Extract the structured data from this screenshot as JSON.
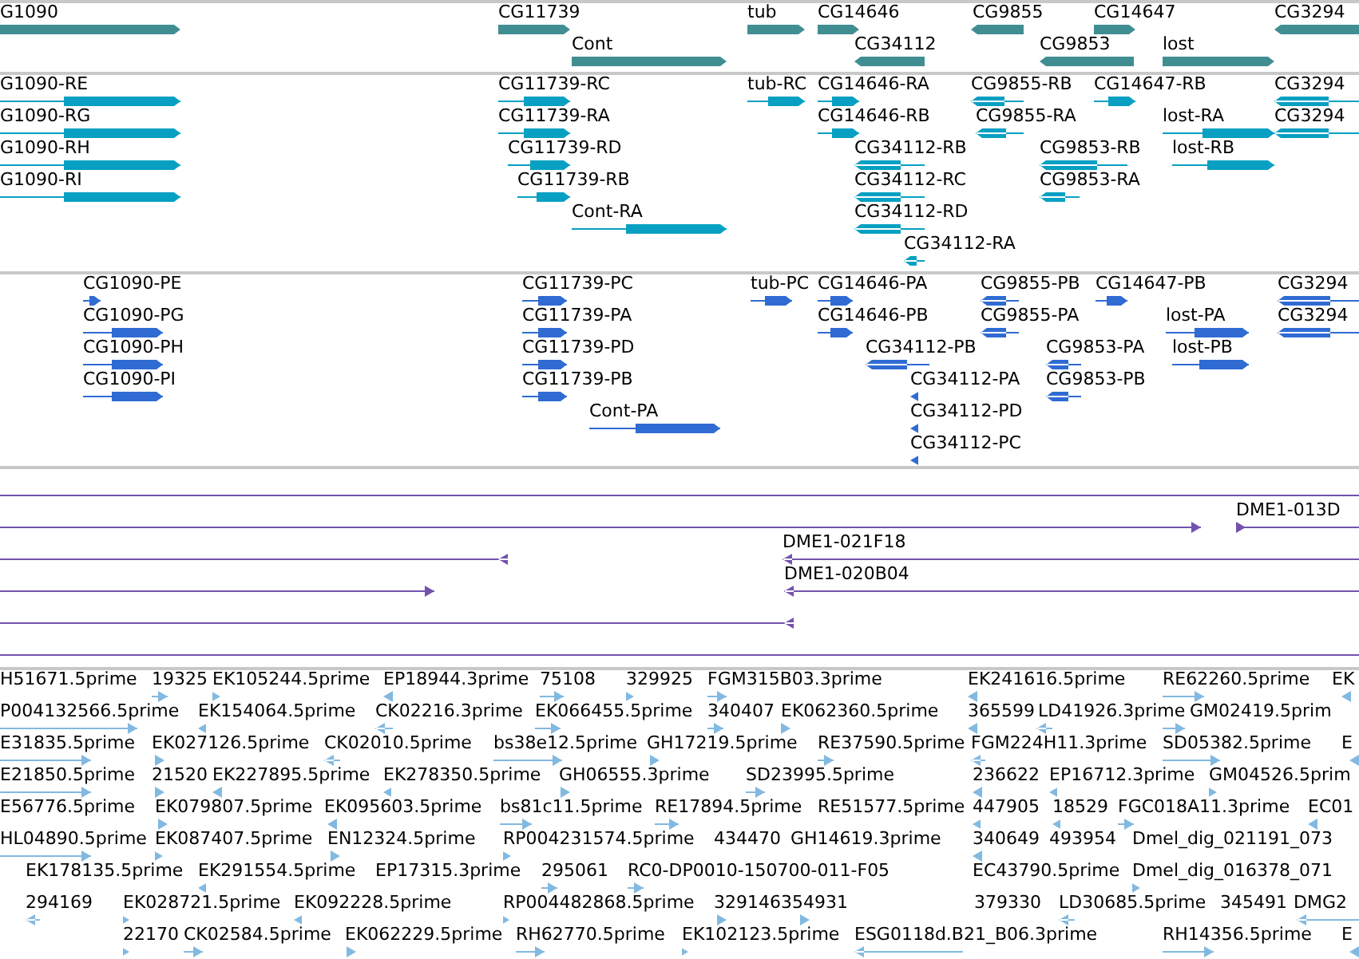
{
  "tracks": [
    {
      "kind": "gene",
      "features": [
        {
          "label": "G1090",
          "reverse": false
        },
        {
          "label": "CG11739",
          "reverse": false
        },
        {
          "label": "Cont",
          "reverse": false
        },
        {
          "label": "tub",
          "reverse": false
        },
        {
          "label": "CG14646",
          "reverse": false
        },
        {
          "label": "CG34112",
          "reverse": true
        },
        {
          "label": "CG9855",
          "reverse": true
        },
        {
          "label": "CG9853",
          "reverse": true
        },
        {
          "label": "CG14647",
          "reverse": false
        },
        {
          "label": "lost",
          "reverse": false
        },
        {
          "label": "CG3294",
          "reverse": true
        }
      ]
    },
    {
      "kind": "transcript",
      "features": [
        {
          "label": "G1090-RE",
          "reverse": false
        },
        {
          "label": "G1090-RG",
          "reverse": false
        },
        {
          "label": "G1090-RH",
          "reverse": false
        },
        {
          "label": "G1090-RI",
          "reverse": false
        },
        {
          "label": "CG11739-RC",
          "reverse": false
        },
        {
          "label": "CG11739-RA",
          "reverse": false
        },
        {
          "label": "CG11739-RD",
          "reverse": false
        },
        {
          "label": "CG11739-RB",
          "reverse": false
        },
        {
          "label": "Cont-RA",
          "reverse": false
        },
        {
          "label": "tub-RC",
          "reverse": false
        },
        {
          "label": "CG14646-RA",
          "reverse": false
        },
        {
          "label": "CG14646-RB",
          "reverse": false
        },
        {
          "label": "CG34112-RB",
          "reverse": true
        },
        {
          "label": "CG34112-RC",
          "reverse": true
        },
        {
          "label": "CG34112-RD",
          "reverse": true
        },
        {
          "label": "CG34112-RA",
          "reverse": true
        },
        {
          "label": "CG9855-RB",
          "reverse": true
        },
        {
          "label": "CG9855-RA",
          "reverse": true
        },
        {
          "label": "CG9853-RB",
          "reverse": true
        },
        {
          "label": "CG9853-RA",
          "reverse": true
        },
        {
          "label": "CG14647-RB",
          "reverse": false
        },
        {
          "label": "lost-RA",
          "reverse": false
        },
        {
          "label": "lost-RB",
          "reverse": false
        },
        {
          "label": "CG3294",
          "reverse": true
        },
        {
          "label": "CG3294",
          "reverse": true
        }
      ]
    },
    {
      "kind": "protein",
      "features": [
        {
          "label": "CG1090-PE",
          "reverse": false
        },
        {
          "label": "CG1090-PG",
          "reverse": false
        },
        {
          "label": "CG1090-PH",
          "reverse": false
        },
        {
          "label": "CG1090-PI",
          "reverse": false
        },
        {
          "label": "CG11739-PC",
          "reverse": false
        },
        {
          "label": "CG11739-PA",
          "reverse": false
        },
        {
          "label": "CG11739-PD",
          "reverse": false
        },
        {
          "label": "CG11739-PB",
          "reverse": false
        },
        {
          "label": "Cont-PA",
          "reverse": false
        },
        {
          "label": "tub-PC",
          "reverse": false
        },
        {
          "label": "CG14646-PA",
          "reverse": false
        },
        {
          "label": "CG14646-PB",
          "reverse": false
        },
        {
          "label": "CG34112-PB",
          "reverse": true
        },
        {
          "label": "CG34112-PA",
          "reverse": true
        },
        {
          "label": "CG34112-PD",
          "reverse": true
        },
        {
          "label": "CG34112-PC",
          "reverse": true
        },
        {
          "label": "CG9855-PB",
          "reverse": true
        },
        {
          "label": "CG9855-PA",
          "reverse": true
        },
        {
          "label": "CG9853-PA",
          "reverse": true
        },
        {
          "label": "CG9853-PB",
          "reverse": true
        },
        {
          "label": "CG14647-PB",
          "reverse": false
        },
        {
          "label": "lost-PA",
          "reverse": false
        },
        {
          "label": "lost-PB",
          "reverse": false
        },
        {
          "label": "CG3294",
          "reverse": true
        },
        {
          "label": "CG3294",
          "reverse": true
        }
      ]
    },
    {
      "kind": "match",
      "features": [
        {
          "end_shown": false
        },
        {
          "reverse": false
        },
        {
          "label": "DME1-013D",
          "reverse": false
        },
        {
          "reverse": true
        },
        {
          "label": "DME1-021F18",
          "reverse": true
        },
        {
          "reverse": false
        },
        {
          "label": "DME1-020B04",
          "reverse": true
        },
        {
          "reverse": true
        },
        {
          "end_shown": false
        }
      ]
    },
    {
      "kind": "est",
      "features": [
        {
          "label": "H51671.5prime"
        },
        {
          "label": "19325",
          "reverse": false
        },
        {
          "label": "EK105244.5prime",
          "reverse": false
        },
        {
          "label": "EP18944.3prime",
          "reverse": true
        },
        {
          "label": "75108",
          "reverse": false
        },
        {
          "label": "329925",
          "reverse": false
        },
        {
          "label": "FGM315B03.3prime",
          "reverse": false
        },
        {
          "label": "EK241616.5prime",
          "reverse": true
        },
        {
          "label": "RE62260.5prime",
          "reverse": false
        },
        {
          "label": "EK",
          "reverse": true
        },
        {
          "label": "P004132566.5prime",
          "reverse": false
        },
        {
          "label": "EK154064.5prime",
          "reverse": true
        },
        {
          "label": "CK02216.3prime",
          "reverse": true
        },
        {
          "label": "EK066455.5prime",
          "reverse": false
        },
        {
          "label": "340407",
          "reverse": false
        },
        {
          "label": "EK062360.5prime",
          "reverse": false
        },
        {
          "label": "365599",
          "reverse": true
        },
        {
          "label": "LD41926.3prime",
          "reverse": true
        },
        {
          "label": "GM02419.5prim",
          "reverse": false
        },
        {
          "label": "E31835.5prime",
          "reverse": false
        },
        {
          "label": "EK027126.5prime",
          "reverse": false
        },
        {
          "label": "CK02010.5prime",
          "reverse": true
        },
        {
          "label": "bs38e12.5prime",
          "reverse": false
        },
        {
          "label": "GH17219.5prime",
          "reverse": false
        },
        {
          "label": "RE37590.5prime",
          "reverse": false
        },
        {
          "label": "FGM224H11.3prime",
          "reverse": true
        },
        {
          "label": "SD05382.5prime",
          "reverse": false
        },
        {
          "label": "E",
          "reverse": true
        },
        {
          "label": "E21850.5prime",
          "reverse": false
        },
        {
          "label": "21520",
          "reverse": false
        },
        {
          "label": "EK227895.5prime",
          "reverse": true
        },
        {
          "label": "EK278350.5prime",
          "reverse": true
        },
        {
          "label": "GH06555.3prime",
          "reverse": false
        },
        {
          "label": "SD23995.5prime",
          "reverse": false
        },
        {
          "label": "236622",
          "reverse": true
        },
        {
          "label": "EP16712.3prime",
          "reverse": true
        },
        {
          "label": "GM04526.5prim",
          "reverse": false
        },
        {
          "label": "E56776.5prime"
        },
        {
          "label": "EK079807.5prime",
          "reverse": false
        },
        {
          "label": "EK095603.5prime",
          "reverse": true
        },
        {
          "label": "bs81c11.5prime",
          "reverse": false
        },
        {
          "label": "RE17894.5prime",
          "reverse": false
        },
        {
          "label": "RE51577.5prime"
        },
        {
          "label": "447905",
          "reverse": true
        },
        {
          "label": "18529",
          "reverse": true
        },
        {
          "label": "FGC018A11.3prime",
          "reverse": false
        },
        {
          "label": "EC01",
          "reverse": true
        },
        {
          "label": "HL04890.5prime",
          "reverse": false
        },
        {
          "label": "EK087407.5prime",
          "reverse": false
        },
        {
          "label": "EN12324.5prime",
          "reverse": false
        },
        {
          "label": "RP004231574.5prime",
          "reverse": false
        },
        {
          "label": "434470"
        },
        {
          "label": "GH14619.3prime"
        },
        {
          "label": "340649",
          "reverse": true
        },
        {
          "label": "493954"
        },
        {
          "label": "Dmel_dig_021191_073"
        },
        {
          "label": "EK178135.5prime"
        },
        {
          "label": "EK291554.5prime",
          "reverse": true
        },
        {
          "label": "EP17315.3prime"
        },
        {
          "label": "295061",
          "reverse": false
        },
        {
          "label": "RC0-DP0010-150700-011-F05",
          "reverse": false
        },
        {
          "label": "EC43790.5prime"
        },
        {
          "label": "Dmel_dig_016378_071",
          "reverse": false
        },
        {
          "label": "294169",
          "reverse": true
        },
        {
          "label": "EK028721.5prime",
          "reverse": false
        },
        {
          "label": "EK092228.5prime",
          "reverse": true
        },
        {
          "label": "RP004482868.5prime",
          "reverse": false
        },
        {
          "label": "329146",
          "reverse": false
        },
        {
          "label": "354931",
          "reverse": false
        },
        {
          "label": "379330"
        },
        {
          "label": "LD30685.5prime",
          "reverse": true
        },
        {
          "label": "345491"
        },
        {
          "label": "DMG2",
          "reverse": true
        },
        {
          "label": "22170",
          "reverse": false
        },
        {
          "label": "CK02584.5prime",
          "reverse": false
        },
        {
          "label": "EK062229.5prime",
          "reverse": false
        },
        {
          "label": "RH62770.5prime",
          "reverse": false
        },
        {
          "label": "EK102123.5prime",
          "reverse": false
        },
        {
          "label": "ESG0118d.B21_B06.3prime",
          "reverse": true
        },
        {
          "label": "RH14356.5prime",
          "reverse": false
        },
        {
          "label": "E",
          "reverse": true
        }
      ]
    }
  ]
}
